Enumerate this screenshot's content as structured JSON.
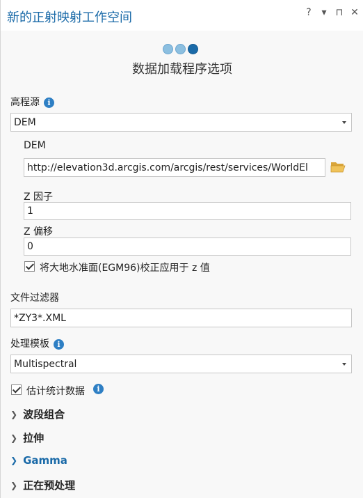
{
  "pane": {
    "title": "新的正射映射工作空间",
    "controls": [
      "?",
      "▾",
      "⊓",
      "✕"
    ]
  },
  "wizard": {
    "title": "数据加载程序选项",
    "steps_total": 3,
    "current_step": 3
  },
  "elevation": {
    "label": "高程源",
    "selected": "DEM",
    "dem_label": "DEM",
    "dem_url": "http://elevation3d.arcgis.com/arcgis/rest/services/WorldEl",
    "z_factor_label": "Z 因子",
    "z_factor": "1",
    "z_offset_label": "Z 偏移",
    "z_offset": "0",
    "geoid_checkbox_label": "将大地水准面(EGM96)校正应用于 z 值",
    "geoid_checked": true
  },
  "file_filter": {
    "label": "文件过滤器",
    "value": "*ZY3*.XML"
  },
  "processing_template": {
    "label": "处理模板",
    "selected": "Multispectral"
  },
  "statistics": {
    "label": "估计统计数据",
    "checked": true
  },
  "sections": [
    {
      "label": "波段组合",
      "accent": false
    },
    {
      "label": "拉伸",
      "accent": false
    },
    {
      "label": "Gamma",
      "accent": true
    },
    {
      "label": "正在预处理",
      "accent": false
    }
  ],
  "colors": {
    "accent": "#1a6aa8",
    "info": "#2e7fc4",
    "folder": "#e8b84a"
  }
}
